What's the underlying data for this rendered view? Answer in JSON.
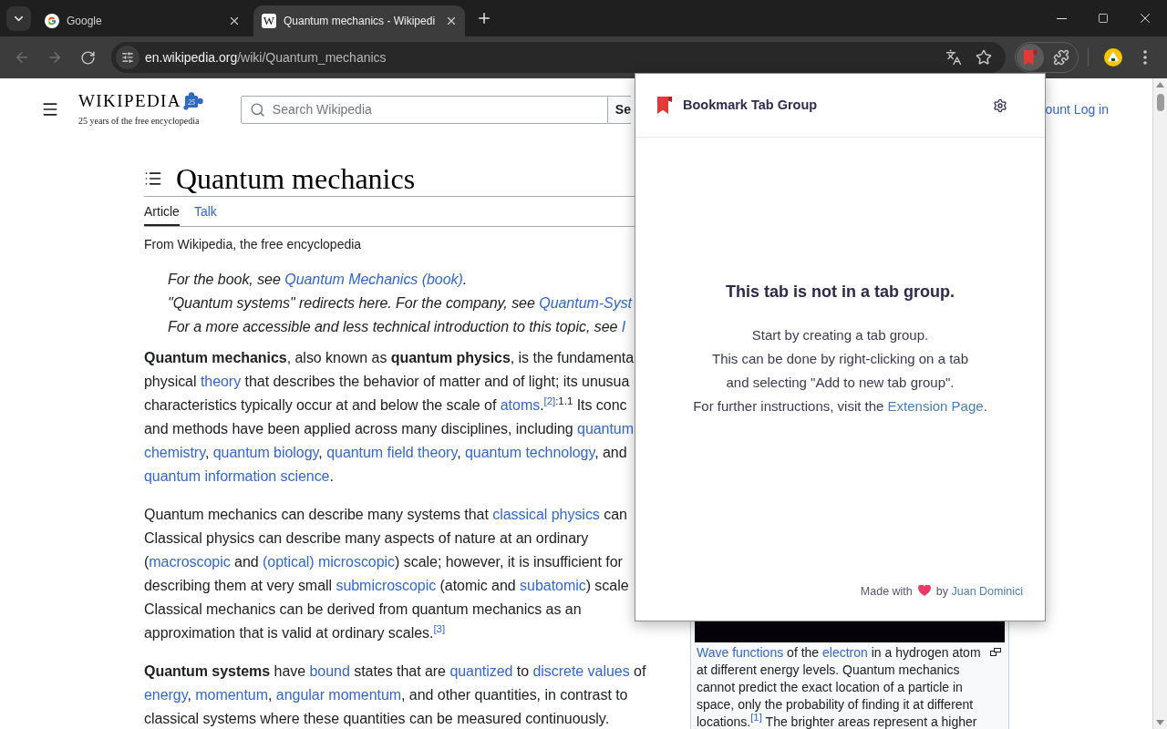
{
  "browser": {
    "tabs": [
      {
        "title": "Google",
        "favicon": {
          "kind": "logo"
        },
        "selected": false
      },
      {
        "title": "Quantum mechanics - Wikipedi",
        "favicon": {
          "kind": "letter",
          "letter": "W"
        },
        "selected": true
      }
    ],
    "back": {
      "disabled": true
    },
    "forward": {
      "disabled": true
    },
    "address": {
      "host": "en.wikipedia.org",
      "path": "/wiki/Quantum_mechanics"
    },
    "extensions": [
      {
        "kind": "bookmark",
        "pressed": true
      },
      {
        "kind": "puzzle",
        "pressed": false
      }
    ]
  },
  "wikipedia": {
    "logo": {
      "wordmark": "WIKIPEDIA",
      "badge": "25",
      "tagline": "25 years of the free encyclopedia"
    },
    "search": {
      "placeholder": "Search Wikipedia",
      "button": "Se"
    },
    "user_links": [
      "ount",
      "Log in"
    ],
    "article": {
      "title": "Quantum mechanics",
      "tabs": [
        {
          "label": "Article",
          "selected": true
        },
        {
          "label": "Talk",
          "selected": false
        }
      ],
      "tagline": "From Wikipedia, the free encyclopedia",
      "hatnotes": [
        [
          {
            "kind": "plain",
            "text": "For the book, see "
          },
          {
            "kind": "link",
            "text": "Quantum Mechanics (book)",
            "after": "."
          }
        ],
        [
          {
            "kind": "plain",
            "text": "\"Quantum systems\" redirects here. For the company, see "
          },
          {
            "kind": "link",
            "text": "Quantum-Syst"
          }
        ],
        [
          {
            "kind": "plain",
            "text": "For a more accessible and less technical introduction to this topic, see "
          },
          {
            "kind": "link",
            "text": "I"
          }
        ]
      ],
      "paragraphs": [
        {
          "lines": [
            [
              {
                "kind": "bold",
                "text": "Quantum mechanics"
              },
              {
                "kind": "plain",
                "text": ", also known as "
              },
              {
                "kind": "bold",
                "text": "quantum physics"
              },
              {
                "kind": "plain",
                "text": ", is the fundamenta"
              }
            ],
            [
              {
                "kind": "plain",
                "text": "physical "
              },
              {
                "kind": "link",
                "text": "theory"
              },
              {
                "kind": "plain",
                "text": " that describes the behavior of matter and of light; its unusua"
              }
            ],
            [
              {
                "kind": "plain",
                "text": "characteristics typically occur at and below the scale of "
              },
              {
                "kind": "link",
                "text": "atoms",
                "after": "."
              },
              {
                "kind": "ref",
                "text": "[2]"
              },
              {
                "kind": "sup",
                "text": ":1.1"
              },
              {
                "kind": "plain",
                "text": " Its conc"
              }
            ],
            [
              {
                "kind": "plain",
                "text": "and methods have been applied across many disciplines, including "
              },
              {
                "kind": "link",
                "text": "quantum"
              }
            ],
            [
              {
                "kind": "link",
                "text": "chemistry",
                "after": ", "
              },
              {
                "kind": "link",
                "text": "quantum biology",
                "after": ", "
              },
              {
                "kind": "link",
                "text": "quantum field theory",
                "after": ", "
              },
              {
                "kind": "link",
                "text": "quantum technology"
              },
              {
                "kind": "plain",
                "text": ", and"
              }
            ],
            [
              {
                "kind": "link",
                "text": "quantum information science",
                "after": "."
              }
            ]
          ]
        },
        {
          "lines": [
            [
              {
                "kind": "plain",
                "text": "Quantum mechanics can describe many systems that "
              },
              {
                "kind": "link",
                "text": "classical physics"
              },
              {
                "kind": "plain",
                "text": " can"
              }
            ],
            [
              {
                "kind": "plain",
                "text": "Classical physics can describe many aspects of nature at an ordinary"
              }
            ],
            [
              {
                "kind": "plain",
                "text": "("
              },
              {
                "kind": "link",
                "text": "macroscopic"
              },
              {
                "kind": "plain",
                "text": " and "
              },
              {
                "kind": "link",
                "text": "(optical) microscopic"
              },
              {
                "kind": "plain",
                "text": ") scale; however, it is insufficient for"
              }
            ],
            [
              {
                "kind": "plain",
                "text": "describing them at very small "
              },
              {
                "kind": "link",
                "text": "submicroscopic"
              },
              {
                "kind": "plain",
                "text": " (atomic and "
              },
              {
                "kind": "link",
                "text": "subatomic"
              },
              {
                "kind": "plain",
                "text": ") scale"
              }
            ],
            [
              {
                "kind": "plain",
                "text": "Classical mechanics can be derived from quantum mechanics as an"
              }
            ],
            [
              {
                "kind": "plain",
                "text": "approximation that is valid at ordinary scales."
              },
              {
                "kind": "ref",
                "text": "[3]"
              }
            ]
          ]
        },
        {
          "lines": [
            [
              {
                "kind": "bold",
                "text": "Quantum systems"
              },
              {
                "kind": "plain",
                "text": " have "
              },
              {
                "kind": "link",
                "text": "bound"
              },
              {
                "kind": "plain",
                "text": " states that are "
              },
              {
                "kind": "link",
                "text": "quantized"
              },
              {
                "kind": "plain",
                "text": " to "
              },
              {
                "kind": "link",
                "text": "discrete values"
              },
              {
                "kind": "plain",
                "text": " of"
              }
            ],
            [
              {
                "kind": "link",
                "text": "energy",
                "after": ", "
              },
              {
                "kind": "link",
                "text": "momentum",
                "after": ", "
              },
              {
                "kind": "link",
                "text": "angular momentum"
              },
              {
                "kind": "plain",
                "text": ", and other quantities, in contrast to"
              }
            ],
            [
              {
                "kind": "plain",
                "text": "classical systems where these quantities can be measured continuously."
              }
            ]
          ]
        }
      ]
    },
    "figure": {
      "caption": [
        [
          {
            "kind": "link",
            "text": "Wave functions"
          },
          {
            "kind": "plain",
            "text": " of the "
          },
          {
            "kind": "link",
            "text": "electron"
          },
          {
            "kind": "plain",
            "text": " in a hydrogen atom"
          }
        ],
        [
          {
            "kind": "plain",
            "text": "at different energy levels. Quantum mechanics"
          }
        ],
        [
          {
            "kind": "plain",
            "text": "cannot predict the exact location of a particle in"
          }
        ],
        [
          {
            "kind": "plain",
            "text": "space, only the probability of finding it at different"
          }
        ],
        [
          {
            "kind": "plain",
            "text": "locations."
          },
          {
            "kind": "ref",
            "text": "[1]"
          },
          {
            "kind": "plain",
            "text": " The brighter areas represent a higher"
          }
        ]
      ]
    }
  },
  "extension_popup": {
    "title": "Bookmark Tab Group",
    "heading": "This tab is not in a tab group.",
    "paragraphs": [
      [
        [
          {
            "kind": "plain",
            "text": "Start by creating a tab group."
          }
        ]
      ],
      [
        [
          {
            "kind": "plain",
            "text": "This can be done by right-clicking on a tab"
          }
        ],
        [
          {
            "kind": "plain",
            "text": "and selecting \"Add to new tab group\"."
          }
        ]
      ],
      [
        [
          {
            "kind": "plain",
            "text": "For further instructions, visit the "
          },
          {
            "kind": "link",
            "text": "Extension Page",
            "after": "."
          }
        ]
      ]
    ],
    "credit": [
      {
        "kind": "plain",
        "text": "Made with"
      },
      {
        "kind": "heart"
      },
      {
        "kind": "plain",
        "text": "by "
      },
      {
        "kind": "link",
        "text": "Juan Dominici"
      }
    ]
  }
}
